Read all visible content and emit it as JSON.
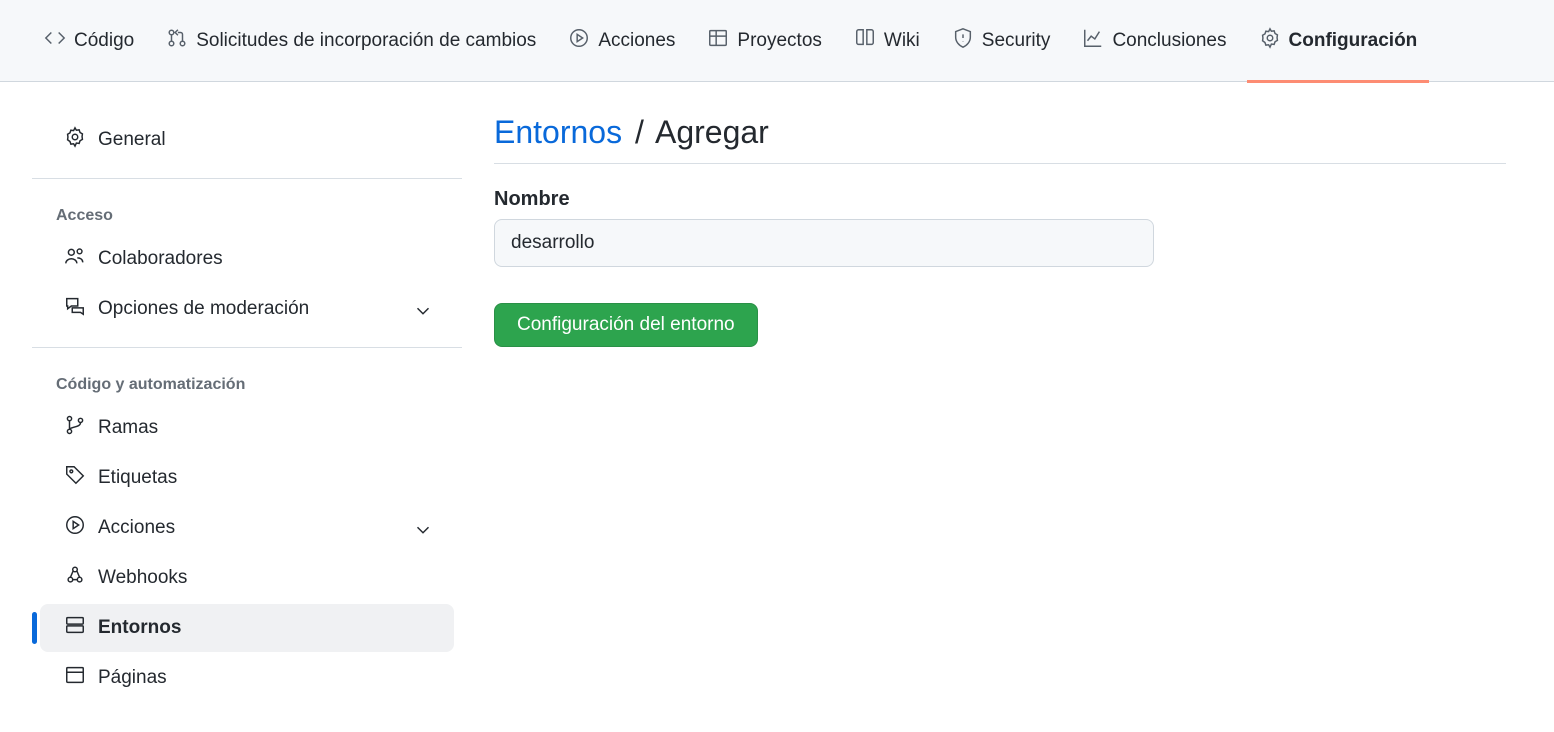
{
  "topnav": {
    "items": [
      {
        "label": "Código"
      },
      {
        "label": "Solicitudes de incorporación de cambios"
      },
      {
        "label": "Acciones"
      },
      {
        "label": "Proyectos"
      },
      {
        "label": "Wiki"
      },
      {
        "label": "Security"
      },
      {
        "label": "Conclusiones"
      },
      {
        "label": "Configuración"
      }
    ]
  },
  "sidebar": {
    "general": {
      "label": "General"
    },
    "groups": [
      {
        "heading": "Acceso",
        "items": [
          {
            "label": "Colaboradores"
          },
          {
            "label": "Opciones de moderación"
          }
        ]
      },
      {
        "heading": "Código y automatización",
        "items": [
          {
            "label": "Ramas"
          },
          {
            "label": "Etiquetas"
          },
          {
            "label": "Acciones"
          },
          {
            "label": "Webhooks"
          },
          {
            "label": "Entornos"
          },
          {
            "label": "Páginas"
          }
        ]
      }
    ]
  },
  "main": {
    "breadcrumb_link": "Entornos",
    "breadcrumb_sep": "/",
    "breadcrumb_current": "Agregar",
    "form": {
      "name_label": "Nombre",
      "name_value": "desarrollo",
      "submit_label": "Configuración del entorno"
    }
  }
}
